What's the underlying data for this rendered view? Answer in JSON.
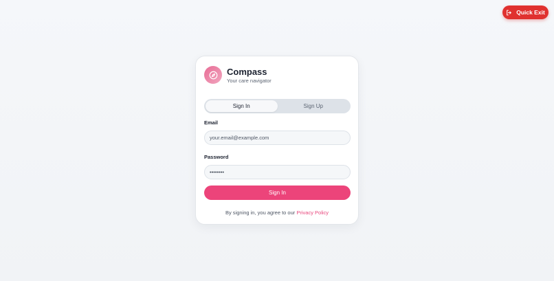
{
  "quick_exit": {
    "label": "Quick Exit",
    "icon": "exit-icon",
    "color": "#e0312f"
  },
  "brand": {
    "title": "Compass",
    "subtitle": "Your care navigator",
    "icon": "compass-icon",
    "accent": "#ec447a"
  },
  "tabs": [
    {
      "label": "Sign In",
      "active": true
    },
    {
      "label": "Sign Up",
      "active": false
    }
  ],
  "form": {
    "email_label": "Email",
    "email_placeholder": "your.email@example.com",
    "password_label": "Password",
    "password_value": "••••••••",
    "submit_label": "Sign In"
  },
  "terms": {
    "text": "By signing in, you agree to our ",
    "link": "Privacy Policy"
  }
}
